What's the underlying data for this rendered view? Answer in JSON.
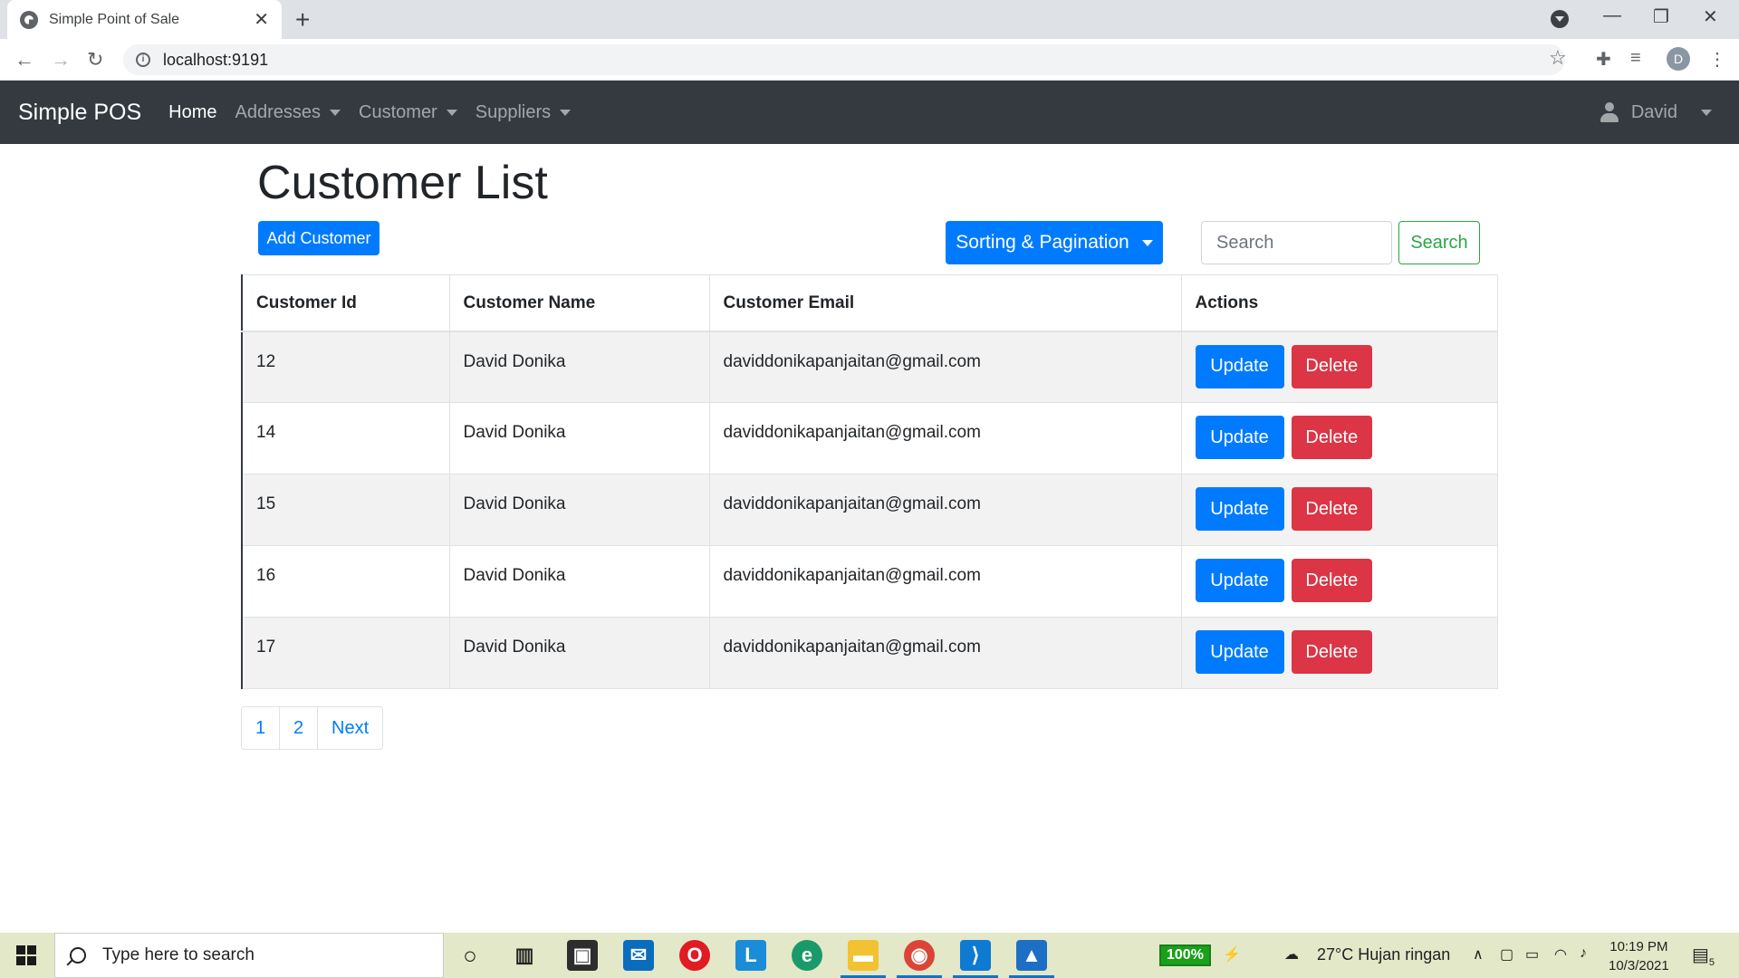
{
  "browser": {
    "tab_title": "Simple Point of Sale",
    "url": "localhost:9191",
    "profile_initial": "D"
  },
  "navbar": {
    "brand": "Simple POS",
    "items": [
      {
        "label": "Home",
        "active": true
      },
      {
        "label": "Addresses",
        "dropdown": true
      },
      {
        "label": "Customer",
        "dropdown": true
      },
      {
        "label": "Suppliers",
        "dropdown": true
      }
    ],
    "user": "David"
  },
  "page": {
    "title": "Customer List",
    "add_button": "Add Customer",
    "sort_button": "Sorting & Pagination",
    "search_placeholder": "Search",
    "search_button": "Search"
  },
  "table": {
    "headers": [
      "Customer Id",
      "Customer Name",
      "Customer Email",
      "Actions"
    ],
    "rows": [
      {
        "id": "12",
        "name": "David Donika",
        "email": "daviddonikapanjaitan@gmail.com"
      },
      {
        "id": "14",
        "name": "David Donika",
        "email": "daviddonikapanjaitan@gmail.com"
      },
      {
        "id": "15",
        "name": "David Donika",
        "email": "daviddonikapanjaitan@gmail.com"
      },
      {
        "id": "16",
        "name": "David Donika",
        "email": "daviddonikapanjaitan@gmail.com"
      },
      {
        "id": "17",
        "name": "David Donika",
        "email": "daviddonikapanjaitan@gmail.com"
      }
    ],
    "update_label": "Update",
    "delete_label": "Delete"
  },
  "pagination": [
    "1",
    "2",
    "Next"
  ],
  "taskbar": {
    "search_placeholder": "Type here to search",
    "battery": "100%",
    "weather": "27°C  Hujan ringan",
    "time": "10:19 PM",
    "date": "10/3/2021",
    "notification_count": "5"
  },
  "colors": {
    "primary": "#007bff",
    "danger": "#dc3545",
    "success": "#28a745",
    "navbar": "#343a40"
  }
}
